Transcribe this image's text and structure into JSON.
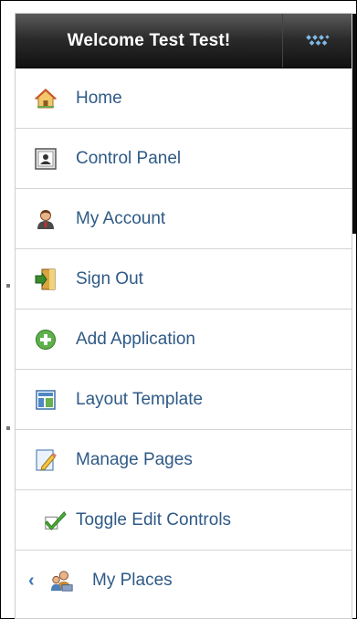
{
  "header": {
    "title": "Welcome Test Test!",
    "toggle_icon": "dock-toggle-icon"
  },
  "menu": {
    "items": [
      {
        "label": "Home",
        "icon": "home-icon"
      },
      {
        "label": "Control Panel",
        "icon": "control-panel-icon"
      },
      {
        "label": "My Account",
        "icon": "user-icon"
      },
      {
        "label": "Sign Out",
        "icon": "door-exit-icon"
      },
      {
        "label": "Add Application",
        "icon": "add-circle-icon"
      },
      {
        "label": "Layout Template",
        "icon": "layout-template-icon"
      },
      {
        "label": "Manage Pages",
        "icon": "edit-pages-icon"
      },
      {
        "label": "Toggle Edit Controls",
        "icon": "checkmark-icon"
      },
      {
        "label": "My Places",
        "icon": "places-icon",
        "submenu_icon": "chevron-left-icon"
      }
    ]
  },
  "colors": {
    "link": "#2f5a86",
    "header_bg": "#1a1a1a",
    "accent_blue": "#3a79b8"
  }
}
